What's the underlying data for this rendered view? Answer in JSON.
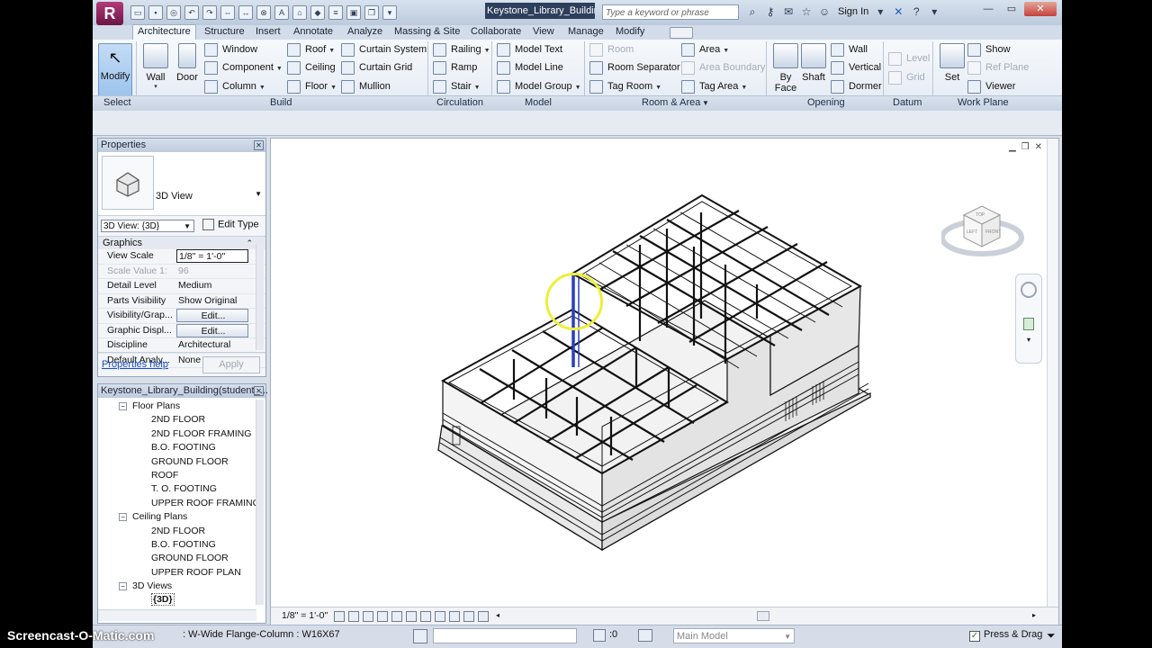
{
  "app": {
    "document_title": "Keystone_Library_Buildin...",
    "search_placeholder": "Type a keyword or phrase",
    "sign_in": "Sign In"
  },
  "tabs": [
    "Architecture",
    "Structure",
    "Insert",
    "Annotate",
    "Analyze",
    "Massing & Site",
    "Collaborate",
    "View",
    "Manage",
    "Modify"
  ],
  "ribbon": {
    "select": {
      "modify": "Modify",
      "panel": "Select"
    },
    "build": {
      "wall": "Wall",
      "door": "Door",
      "window": "Window",
      "component": "Component",
      "column": "Column",
      "roof": "Roof",
      "ceiling": "Ceiling",
      "floor": "Floor",
      "curtain_system": "Curtain System",
      "curtain_grid": "Curtain  Grid",
      "mullion": "Mullion",
      "panel": "Build"
    },
    "circulation": {
      "railing": "Railing",
      "ramp": "Ramp",
      "stair": "Stair",
      "panel": "Circulation"
    },
    "model": {
      "model_text": "Model  Text",
      "model_line": "Model  Line",
      "model_group": "Model  Group",
      "panel": "Model"
    },
    "room_area": {
      "room": "Room",
      "room_separator": "Room  Separator",
      "tag_room": "Tag  Room",
      "area": "Area",
      "area_boundary": "Area  Boundary",
      "tag_area": "Tag  Area",
      "panel": "Room & Area"
    },
    "opening": {
      "by_face": "By",
      "by_face2": "Face",
      "shaft": "Shaft",
      "wall": "Wall",
      "vertical": "Vertical",
      "dormer": "Dormer",
      "panel": "Opening"
    },
    "datum": {
      "level": "Level",
      "grid": "Grid",
      "panel": "Datum"
    },
    "work_plane": {
      "set": "Set",
      "show": "Show",
      "ref_plane": "Ref  Plane",
      "viewer": "Viewer",
      "panel": "Work Plane"
    }
  },
  "properties": {
    "title": "Properties",
    "type_name": "3D View",
    "view_selector": "3D View: {3D}",
    "edit_type": "Edit Type",
    "group": "Graphics",
    "rows": [
      {
        "k": "View Scale",
        "v": "1/8\" = 1'-0\""
      },
      {
        "k": "Scale Value    1:",
        "v": "96"
      },
      {
        "k": "Detail Level",
        "v": "Medium"
      },
      {
        "k": "Parts Visibility",
        "v": "Show Original"
      },
      {
        "k": "Visibility/Grap...",
        "v": "Edit..."
      },
      {
        "k": "Graphic Displ...",
        "v": "Edit..."
      },
      {
        "k": "Discipline",
        "v": "Architectural"
      },
      {
        "k": "Default Analy...",
        "v": "None"
      }
    ],
    "help": "Properties help",
    "apply": "Apply"
  },
  "browser": {
    "title": "Keystone_Library_Building(student_...",
    "items": [
      {
        "label": "Floor Plans",
        "level": 1
      },
      {
        "label": "2ND FLOOR",
        "level": 2
      },
      {
        "label": "2ND FLOOR FRAMING",
        "level": 2
      },
      {
        "label": "B.O. FOOTING",
        "level": 2
      },
      {
        "label": "GROUND FLOOR",
        "level": 2
      },
      {
        "label": "ROOF",
        "level": 2
      },
      {
        "label": "T. O. FOOTING",
        "level": 2
      },
      {
        "label": "UPPER ROOF FRAMING",
        "level": 2
      },
      {
        "label": "Ceiling Plans",
        "level": 1
      },
      {
        "label": "2ND FLOOR",
        "level": 2
      },
      {
        "label": "B.O. FOOTING",
        "level": 2
      },
      {
        "label": "GROUND FLOOR",
        "level": 2
      },
      {
        "label": "UPPER ROOF PLAN",
        "level": 2
      },
      {
        "label": "3D Views",
        "level": 1
      },
      {
        "label": "{3D}",
        "level": 2,
        "active": true
      }
    ]
  },
  "view": {
    "scale": "1/8\" = 1'-0\"",
    "viewcube_top": "TOP",
    "viewcube_left": "LEFT",
    "viewcube_front": "FRONT"
  },
  "status": {
    "text": ": W-Wide Flange-Column : W16X67",
    "zero": ":0",
    "model": "Main Model",
    "press_drag": "Press & Drag"
  },
  "watermark": "Screencast-O-Matic.com"
}
